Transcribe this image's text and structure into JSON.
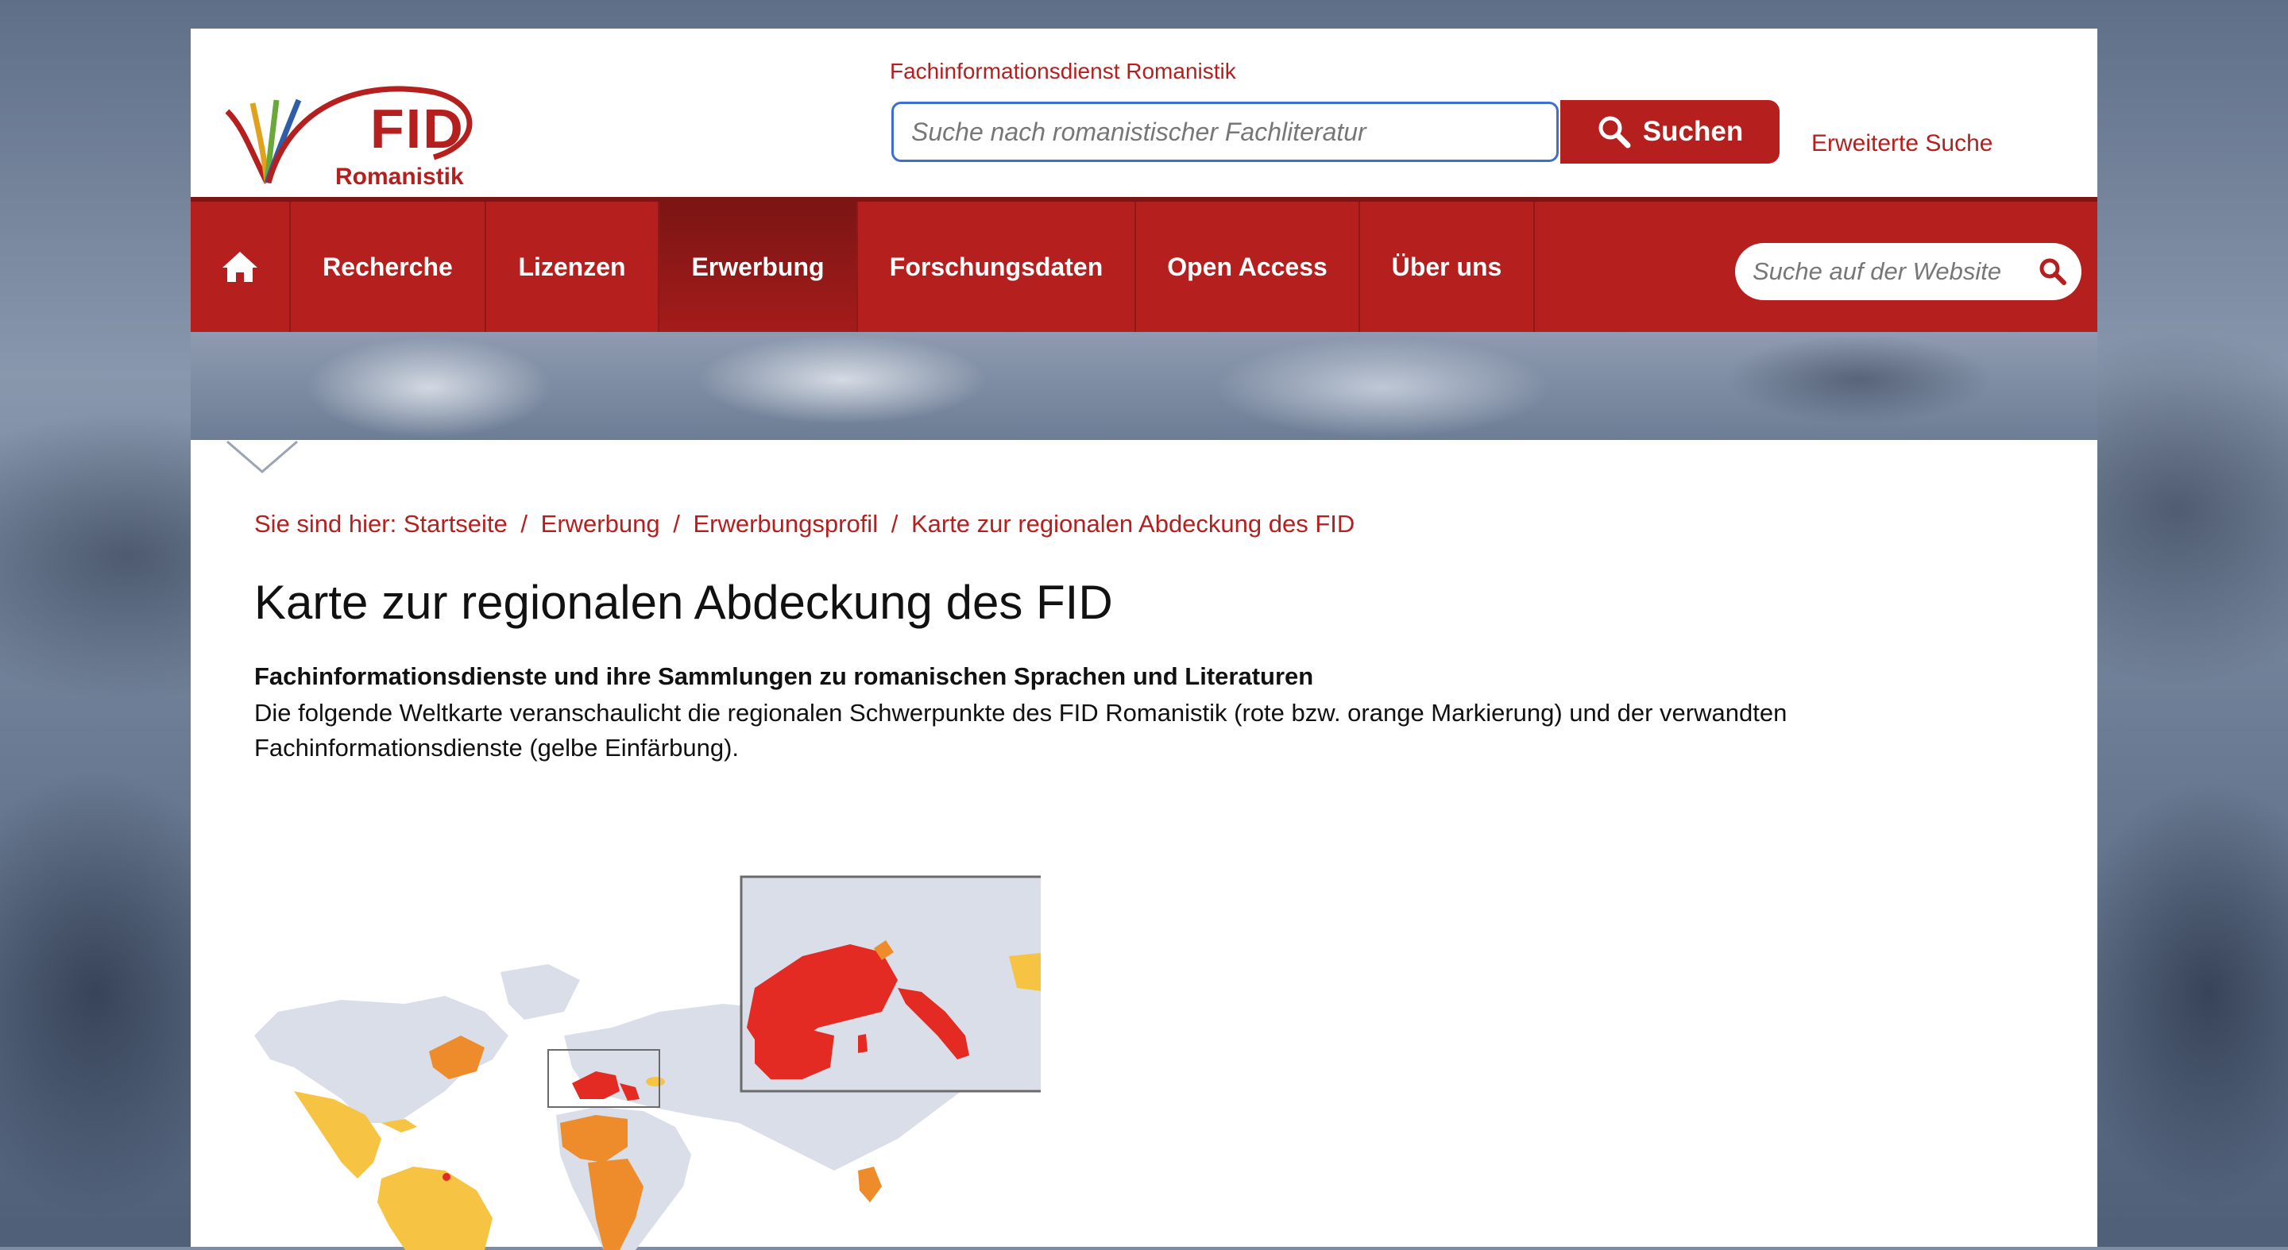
{
  "header": {
    "logo_text": "FID",
    "logo_subtext": "Romanistik",
    "tagline": "Fachinformationsdienst Romanistik",
    "search_placeholder": "Suche nach romanistischer Fachliteratur",
    "search_button_label": "Suchen",
    "advanced_search_label": "Erweiterte Suche"
  },
  "nav": {
    "items": [
      {
        "label": "Recherche"
      },
      {
        "label": "Lizenzen"
      },
      {
        "label": "Erwerbung",
        "active": true
      },
      {
        "label": "Forschungsdaten"
      },
      {
        "label": "Open Access"
      },
      {
        "label": "Über uns"
      }
    ],
    "site_search_placeholder": "Suche auf der Website"
  },
  "content": {
    "breadcrumb": {
      "prefix": "Sie sind hier:",
      "items": [
        "Startseite",
        "Erwerbung",
        "Erwerbungsprofil",
        "Karte zur regionalen Abdeckung des FID"
      ]
    },
    "title": "Karte zur regionalen Abdeckung des FID",
    "subheading": "Fachinformationsdienste und ihre Sammlungen zu romanischen Sprachen und Literaturen",
    "description": "Die folgende Weltkarte veranschaulicht die regionalen Schwerpunkte des FID Romanistik (rote bzw. orange Markierung) und der verwandten Fachinformationsdienste (gelbe Einfärbung)."
  },
  "colors": {
    "brand_red": "#b5201f",
    "map_red": "#e32b23",
    "map_orange": "#ee8b2a",
    "map_yellow": "#f6c342",
    "map_land": "#d9dee9"
  }
}
